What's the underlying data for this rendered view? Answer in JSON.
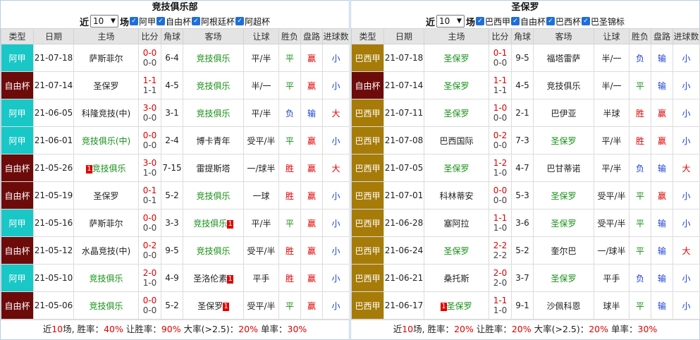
{
  "headers": [
    "类型",
    "日期",
    "主场",
    "比分",
    "角球",
    "客场",
    "让球",
    "胜负",
    "盘路",
    "进球数"
  ],
  "left": {
    "title": "竞技俱乐部",
    "recent_label": "近",
    "count": "10",
    "match_label": "场",
    "filters": [
      "阿甲",
      "自由杯",
      "阿根廷杯",
      "阿超杯"
    ],
    "rows": [
      {
        "type": "阿甲",
        "tc": "t-aj",
        "date": "21-07-18",
        "home": "萨斯菲尔",
        "hc": "",
        "hr": "",
        "ft": "0-0",
        "ht": "0-0",
        "corner": "6-4",
        "away": "竞技俱乐",
        "ac": "green",
        "ar": "",
        "hcap": "平/半",
        "wl": "平",
        "wlc": "green",
        "pan": "赢",
        "panc": "red",
        "goals": "小",
        "gc": "blue"
      },
      {
        "type": "自由杯",
        "tc": "t-zy",
        "date": "21-07-14",
        "home": "圣保罗",
        "hc": "",
        "hr": "",
        "ft": "1-1",
        "ht": "1-1",
        "corner": "4-5",
        "away": "竞技俱乐",
        "ac": "green",
        "ar": "",
        "hcap": "半/一",
        "wl": "平",
        "wlc": "green",
        "pan": "赢",
        "panc": "red",
        "goals": "小",
        "gc": "blue"
      },
      {
        "type": "阿甲",
        "tc": "t-aj",
        "date": "21-06-05",
        "home": "科隆竞技(中)",
        "hc": "",
        "hr": "",
        "ft": "3-0",
        "ht": "0-0",
        "corner": "3-1",
        "away": "竞技俱乐",
        "ac": "green",
        "ar": "",
        "hcap": "平/半",
        "wl": "负",
        "wlc": "blue",
        "pan": "输",
        "panc": "blue",
        "goals": "大",
        "gc": "red"
      },
      {
        "type": "阿甲",
        "tc": "t-aj",
        "date": "21-06-01",
        "home": "竞技俱乐(中)",
        "hc": "green",
        "hr": "",
        "ft": "0-0",
        "ht": "0-0",
        "corner": "2-4",
        "away": "博卡青年",
        "ac": "",
        "ar": "",
        "hcap": "受平/半",
        "wl": "平",
        "wlc": "green",
        "pan": "赢",
        "panc": "red",
        "goals": "小",
        "gc": "blue"
      },
      {
        "type": "自由杯",
        "tc": "t-zy",
        "date": "21-05-26",
        "home": "竞技俱乐",
        "hc": "green",
        "hr": "1",
        "ft": "3-0",
        "ht": "1-0",
        "corner": "7-15",
        "away": "雷提斯塔",
        "ac": "",
        "ar": "",
        "hcap": "一/球半",
        "wl": "胜",
        "wlc": "red",
        "pan": "赢",
        "panc": "red",
        "goals": "大",
        "gc": "red"
      },
      {
        "type": "自由杯",
        "tc": "t-zy",
        "date": "21-05-19",
        "home": "圣保罗",
        "hc": "",
        "hr": "",
        "ft": "0-1",
        "ht": "0-1",
        "corner": "5-2",
        "away": "竞技俱乐",
        "ac": "green",
        "ar": "",
        "hcap": "一球",
        "wl": "胜",
        "wlc": "red",
        "pan": "赢",
        "panc": "red",
        "goals": "小",
        "gc": "blue"
      },
      {
        "type": "阿甲",
        "tc": "t-aj",
        "date": "21-05-16",
        "home": "萨斯菲尔",
        "hc": "",
        "hr": "",
        "ft": "0-0",
        "ht": "0-0",
        "corner": "3-3",
        "away": "竞技俱乐",
        "ac": "green",
        "ar": "1",
        "hcap": "平/半",
        "wl": "平",
        "wlc": "green",
        "pan": "赢",
        "panc": "red",
        "goals": "小",
        "gc": "blue"
      },
      {
        "type": "自由杯",
        "tc": "t-zy",
        "date": "21-05-12",
        "home": "水晶竞技(中)",
        "hc": "",
        "hr": "",
        "ft": "0-2",
        "ht": "0-0",
        "corner": "9-5",
        "away": "竞技俱乐",
        "ac": "green",
        "ar": "",
        "hcap": "受平/半",
        "wl": "胜",
        "wlc": "red",
        "pan": "赢",
        "panc": "red",
        "goals": "小",
        "gc": "blue"
      },
      {
        "type": "阿甲",
        "tc": "t-aj",
        "date": "21-05-10",
        "home": "竞技俱乐",
        "hc": "green",
        "hr": "",
        "ft": "2-0",
        "ht": "1-0",
        "corner": "4-9",
        "away": "圣洛伦素",
        "ac": "",
        "ar": "1",
        "hcap": "平手",
        "wl": "胜",
        "wlc": "red",
        "pan": "赢",
        "panc": "red",
        "goals": "小",
        "gc": "blue"
      },
      {
        "type": "自由杯",
        "tc": "t-zy",
        "date": "21-05-06",
        "home": "竞技俱乐",
        "hc": "green",
        "hr": "",
        "ft": "0-0",
        "ht": "0-0",
        "corner": "5-2",
        "away": "圣保罗",
        "ac": "",
        "ar": "1",
        "hcap": "受平/半",
        "wl": "平",
        "wlc": "green",
        "pan": "赢",
        "panc": "red",
        "goals": "小",
        "gc": "blue"
      }
    ],
    "summary": {
      "pre": "近",
      "n": "10",
      "s1": "场, 胜率：",
      "win": "40%",
      "s2": " 让胜率：",
      "hwin": "90%",
      "s3": " 大率(>2.5)：",
      "big": "20%",
      "s4": " 单率：",
      "odd": "30%"
    }
  },
  "right": {
    "title": "圣保罗",
    "recent_label": "近",
    "count": "10",
    "match_label": "场",
    "filters": [
      "巴西甲",
      "自由杯",
      "巴西杯",
      "巴圣锦标"
    ],
    "rows": [
      {
        "type": "巴西甲",
        "tc": "t-bx",
        "date": "21-07-18",
        "home": "圣保罗",
        "hc": "green",
        "hr": "",
        "ft": "0-1",
        "ht": "0-0",
        "corner": "9-5",
        "away": "福塔雷萨",
        "ac": "",
        "ar": "",
        "hcap": "半/一",
        "wl": "负",
        "wlc": "blue",
        "pan": "输",
        "panc": "blue",
        "goals": "小",
        "gc": "blue"
      },
      {
        "type": "自由杯",
        "tc": "t-zy",
        "date": "21-07-14",
        "home": "圣保罗",
        "hc": "green",
        "hr": "",
        "ft": "1-1",
        "ht": "1-1",
        "corner": "4-5",
        "away": "竞技俱乐",
        "ac": "",
        "ar": "",
        "hcap": "半/一",
        "wl": "平",
        "wlc": "green",
        "pan": "输",
        "panc": "blue",
        "goals": "小",
        "gc": "blue"
      },
      {
        "type": "巴西甲",
        "tc": "t-bx",
        "date": "21-07-11",
        "home": "圣保罗",
        "hc": "green",
        "hr": "",
        "ft": "1-0",
        "ht": "0-0",
        "corner": "2-1",
        "away": "巴伊亚",
        "ac": "",
        "ar": "",
        "hcap": "半球",
        "wl": "胜",
        "wlc": "red",
        "pan": "赢",
        "panc": "red",
        "goals": "小",
        "gc": "blue"
      },
      {
        "type": "巴西甲",
        "tc": "t-bx",
        "date": "21-07-08",
        "home": "巴西国际",
        "hc": "",
        "hr": "",
        "ft": "0-2",
        "ht": "0-0",
        "corner": "7-3",
        "away": "圣保罗",
        "ac": "green",
        "ar": "",
        "hcap": "平/半",
        "wl": "胜",
        "wlc": "red",
        "pan": "赢",
        "panc": "red",
        "goals": "小",
        "gc": "blue"
      },
      {
        "type": "巴西甲",
        "tc": "t-bx",
        "date": "21-07-05",
        "home": "圣保罗",
        "hc": "green",
        "hr": "",
        "ft": "1-2",
        "ht": "1-0",
        "corner": "4-7",
        "away": "巴甘蒂诺",
        "ac": "",
        "ar": "",
        "hcap": "平/半",
        "wl": "负",
        "wlc": "blue",
        "pan": "输",
        "panc": "blue",
        "goals": "大",
        "gc": "red"
      },
      {
        "type": "巴西甲",
        "tc": "t-bx",
        "date": "21-07-01",
        "home": "科林蒂安",
        "hc": "",
        "hr": "",
        "ft": "0-0",
        "ht": "0-0",
        "corner": "5-3",
        "away": "圣保罗",
        "ac": "green",
        "ar": "",
        "hcap": "受平/半",
        "wl": "平",
        "wlc": "green",
        "pan": "赢",
        "panc": "red",
        "goals": "小",
        "gc": "blue"
      },
      {
        "type": "巴西甲",
        "tc": "t-bx",
        "date": "21-06-28",
        "home": "塞阿拉",
        "hc": "",
        "hr": "",
        "ft": "1-1",
        "ht": "1-0",
        "corner": "3-6",
        "away": "圣保罗",
        "ac": "green",
        "ar": "",
        "hcap": "受平/半",
        "wl": "平",
        "wlc": "green",
        "pan": "输",
        "panc": "blue",
        "goals": "小",
        "gc": "blue"
      },
      {
        "type": "巴西甲",
        "tc": "t-bx",
        "date": "21-06-24",
        "home": "圣保罗",
        "hc": "green",
        "hr": "",
        "ft": "2-2",
        "ht": "2-2",
        "corner": "5-2",
        "away": "奎尔巴",
        "ac": "",
        "ar": "",
        "hcap": "一/球半",
        "wl": "平",
        "wlc": "green",
        "pan": "输",
        "panc": "blue",
        "goals": "大",
        "gc": "red"
      },
      {
        "type": "巴西甲",
        "tc": "t-bx",
        "date": "21-06-21",
        "home": "桑托斯",
        "hc": "",
        "hr": "",
        "ft": "2-0",
        "ht": "2-0",
        "corner": "3-7",
        "away": "圣保罗",
        "ac": "green",
        "ar": "",
        "hcap": "平手",
        "wl": "负",
        "wlc": "blue",
        "pan": "输",
        "panc": "blue",
        "goals": "小",
        "gc": "blue"
      },
      {
        "type": "巴西甲",
        "tc": "t-bx",
        "date": "21-06-17",
        "home": "圣保罗",
        "hc": "green",
        "hr": "1",
        "ft": "1-1",
        "ht": "1-0",
        "corner": "9-1",
        "away": "沙佩科恩",
        "ac": "",
        "ar": "",
        "hcap": "球半",
        "wl": "平",
        "wlc": "green",
        "pan": "输",
        "panc": "blue",
        "goals": "小",
        "gc": "blue"
      }
    ],
    "summary": {
      "pre": "近",
      "n": "10",
      "s1": "场, 胜率：",
      "win": "20%",
      "s2": " 让胜率：",
      "hwin": "20%",
      "s3": " 大率(>2.5)：",
      "big": "20%",
      "s4": " 单率：",
      "odd": "30%"
    }
  }
}
